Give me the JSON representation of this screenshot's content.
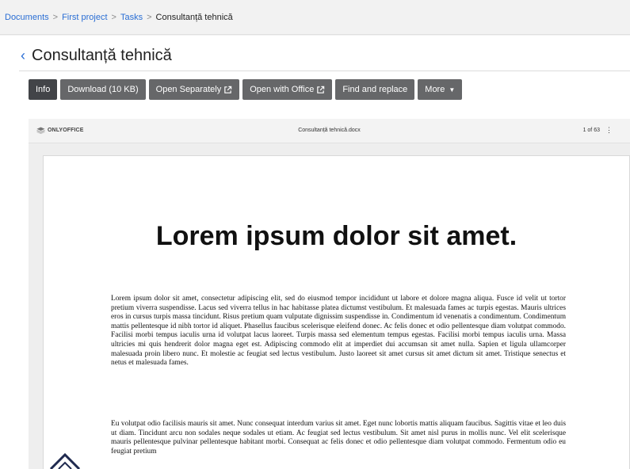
{
  "breadcrumb": {
    "items": [
      "Documents",
      "First project",
      "Tasks"
    ],
    "current": "Consultanță tehnică",
    "separator": ">"
  },
  "page": {
    "title": "Consultanță tehnică",
    "back_icon": "chevron-left-icon"
  },
  "toolbar": {
    "info": "Info",
    "download": "Download (10 KB)",
    "open_separately": "Open Separately",
    "open_office": "Open with Office",
    "find_replace": "Find and replace",
    "more": "More",
    "external_icon": "external-link-icon",
    "caret_icon": "caret-down-icon"
  },
  "viewer": {
    "brand": "ONLYOFFICE",
    "file_name": "Consultanță tehnică.docx",
    "page_count": "1 of 63",
    "menu_icon": "kebab-menu-icon"
  },
  "document": {
    "heading": "Lorem ipsum dolor sit amet.",
    "paragraphs": [
      "Lorem ipsum dolor sit amet, consectetur adipiscing elit, sed do eiusmod tempor incididunt ut labore et dolore magna aliqua. Fusce id velit ut tortor pretium viverra suspendisse. Lacus sed viverra tellus in hac habitasse platea dictumst vestibulum. Et malesuada fames ac turpis egestas. Mauris ultrices eros in cursus turpis massa tincidunt. Risus pretium quam vulputate dignissim suspendisse in. Condimentum id venenatis a condimentum. Condimentum mattis pellentesque id nibh tortor id aliquet. Phasellus faucibus scelerisque eleifend donec. Ac felis donec et odio pellentesque diam volutpat commodo. Facilisi morbi tempus iaculis urna id volutpat lacus laoreet. Turpis massa sed elementum tempus egestas. Facilisi morbi tempus iaculis urna. Massa ultricies mi quis hendrerit dolor magna eget est. Adipiscing commodo elit at imperdiet dui accumsan sit amet nulla. Sapien et ligula ullamcorper malesuada proin libero nunc. Et molestie ac feugiat sed lectus vestibulum. Justo laoreet sit amet cursus sit amet dictum sit amet. Tristique senectus et netus et malesuada fames.",
      "Eu volutpat odio facilisis mauris sit amet. Nunc consequat interdum varius sit amet. Eget nunc lobortis mattis aliquam faucibus. Sagittis vitae et leo duis ut diam. Tincidunt arcu non sodales neque sodales ut etiam. Ac feugiat sed lectus vestibulum. Sit amet nisl purus in mollis nunc. Vel elit scelerisque mauris pellentesque pulvinar pellentesque habitant morbi. Consequat ac felis donec et odio pellentesque diam volutpat commodo. Fermentum odio eu feugiat pretium"
    ]
  },
  "colors": {
    "link": "#2a6ed4",
    "button": "#666769",
    "button_active": "#424448"
  }
}
